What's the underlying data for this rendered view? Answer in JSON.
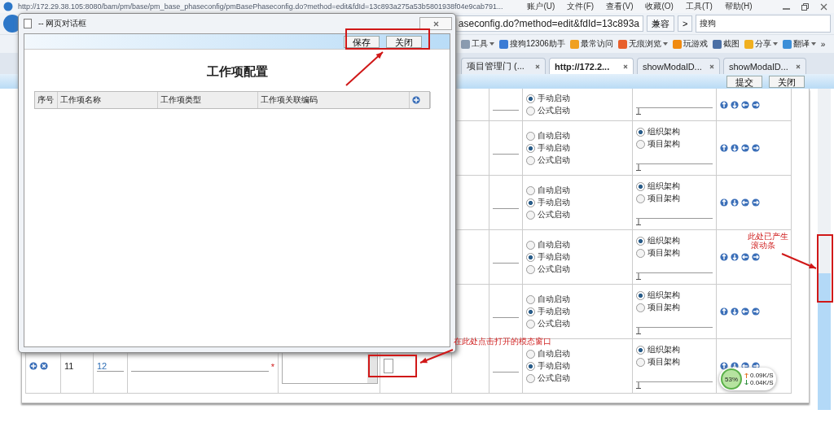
{
  "browser": {
    "url_title": "http://172.29.38.105:8080/bam/pm/base/pm_base_phaseconfig/pmBasePhaseconfig.do?method=edit&fdId=13c893a275a53b5801938f04e9cab791...",
    "menu": [
      "账户(U)",
      "文件(F)",
      "查看(V)",
      "收藏(O)",
      "工具(T)",
      "帮助(H)"
    ],
    "address": "aseconfig.do?method=edit&fdId=13c893a",
    "compat_button": "兼容",
    "next_button": ">",
    "search": {
      "value": "搜狗"
    },
    "bookmarks": [
      {
        "label": "工具",
        "dropdown": true,
        "color": "#8a9bb0"
      },
      {
        "label": "搜狗12306助手",
        "dropdown": false,
        "color": "#3a7bd5"
      },
      {
        "label": "最常访问",
        "dropdown": false,
        "color": "#f0a020"
      },
      {
        "label": "无痕浏览",
        "dropdown": true,
        "color": "#e8602c"
      },
      {
        "label": "玩游戏",
        "dropdown": false,
        "color": "#f08a10"
      },
      {
        "label": "截图",
        "dropdown": false,
        "color": "#4a6fa5"
      },
      {
        "label": "分享",
        "dropdown": true,
        "color": "#f0b020"
      },
      {
        "label": "翻译",
        "dropdown": true,
        "color": "#3d8fd8"
      }
    ],
    "more": "»",
    "tabs": [
      {
        "label": "项目管理门 (...",
        "selected": false
      },
      {
        "label": "http://172.2...",
        "selected": true
      },
      {
        "label": "showModalD...",
        "selected": false
      },
      {
        "label": "showModalD...",
        "selected": false
      }
    ]
  },
  "page": {
    "buttons": [
      "提交",
      "关闭"
    ],
    "rows": [
      {
        "launch": [
          {
            "label": "手动启动",
            "selected": true
          },
          {
            "label": "公式启动",
            "selected": false
          }
        ]
      },
      {
        "launch": [
          {
            "label": "自动启动",
            "selected": false
          },
          {
            "label": "手动启动",
            "selected": true
          },
          {
            "label": "公式启动",
            "selected": false
          }
        ],
        "structure": [
          {
            "label": "组织架构",
            "selected": true
          },
          {
            "label": "项目架构",
            "selected": false
          }
        ]
      },
      {
        "launch": [
          {
            "label": "自动启动",
            "selected": false
          },
          {
            "label": "手动启动",
            "selected": true
          },
          {
            "label": "公式启动",
            "selected": false
          }
        ],
        "structure": [
          {
            "label": "组织架构",
            "selected": true
          },
          {
            "label": "项目架构",
            "selected": false
          }
        ]
      },
      {
        "launch": [
          {
            "label": "自动启动",
            "selected": false
          },
          {
            "label": "手动启动",
            "selected": true
          },
          {
            "label": "公式启动",
            "selected": false
          }
        ],
        "structure": [
          {
            "label": "组织架构",
            "selected": true
          },
          {
            "label": "项目架构",
            "selected": false
          }
        ]
      },
      {
        "launch": [
          {
            "label": "自动启动",
            "selected": false
          },
          {
            "label": "手动启动",
            "selected": true
          },
          {
            "label": "公式启动",
            "selected": false
          }
        ],
        "structure": [
          {
            "label": "组织架构",
            "selected": true
          },
          {
            "label": "项目架构",
            "selected": false
          }
        ]
      },
      {
        "number": "11",
        "code": "12",
        "required_mark": "*",
        "launch": [
          {
            "label": "自动启动",
            "selected": false
          },
          {
            "label": "手动启动",
            "selected": true
          },
          {
            "label": "公式启动",
            "selected": false
          }
        ],
        "structure": [
          {
            "label": "组织架构",
            "selected": true
          },
          {
            "label": "项目架构",
            "selected": false
          }
        ]
      }
    ]
  },
  "dialog": {
    "title": "-- 网页对话框",
    "buttons": [
      "保存",
      "关闭"
    ],
    "heading": "工作项配置",
    "columns": [
      "序号",
      "工作项名称",
      "工作项类型",
      "工作项关联编码"
    ]
  },
  "annotations": {
    "modal_note": "在此处点击打开的模态窗口",
    "scroll_note": [
      "此处已产生",
      "滚动条"
    ]
  },
  "speed_widget": {
    "percent": "53%",
    "up": "0.09K/S",
    "down": "0.04K/S"
  }
}
